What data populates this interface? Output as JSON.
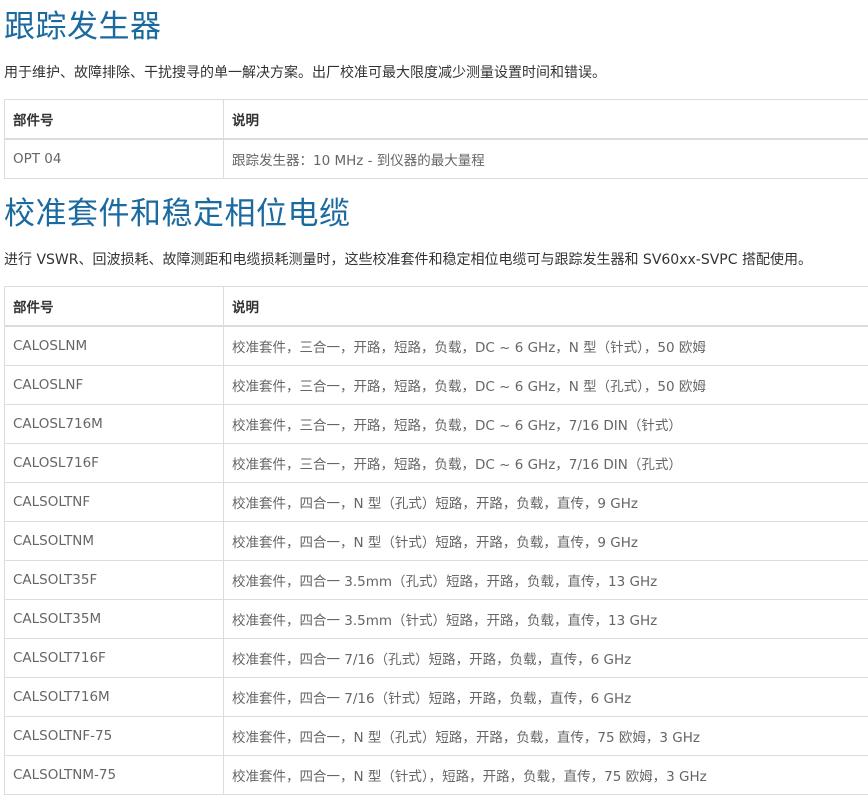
{
  "tracking_generator": {
    "title": "跟踪发生器",
    "description": "用于维护、故障排除、干扰搜寻的单一解决方案。出厂校准可最大限度减少测量设置时间和错误。",
    "headers": {
      "part": "部件号",
      "desc": "说明"
    },
    "rows": [
      {
        "part": "OPT 04",
        "desc": "跟踪发生器：10 MHz - 到仪器的最大量程"
      }
    ]
  },
  "calibration_kits": {
    "title": "校准套件和稳定相位电缆",
    "description": "进行 VSWR、回波损耗、故障测距和电缆损耗测量时，这些校准套件和稳定相位电缆可与跟踪发生器和 SV60xx-SVPC 搭配使用。",
    "headers": {
      "part": "部件号",
      "desc": "说明"
    },
    "rows": [
      {
        "part": "CALOSLNM",
        "desc": "校准套件，三合一，开路，短路，负载，DC ~ 6 GHz，N 型（针式），50 欧姆"
      },
      {
        "part": "CALOSLNF",
        "desc": "校准套件，三合一，开路，短路，负载，DC ~ 6 GHz，N 型（孔式），50 欧姆"
      },
      {
        "part": "CALOSL716M",
        "desc": "校准套件，三合一，开路，短路，负载，DC ~ 6 GHz，7/16 DIN（针式）"
      },
      {
        "part": "CALOSL716F",
        "desc": "校准套件，三合一，开路，短路，负载，DC ~ 6 GHz，7/16 DIN（孔式）"
      },
      {
        "part": "CALSOLTNF",
        "desc": "校准套件，四合一，N 型（孔式）短路，开路，负载，直传，9 GHz"
      },
      {
        "part": "CALSOLTNM",
        "desc": "校准套件，四合一，N 型（针式）短路，开路，负载，直传，9 GHz"
      },
      {
        "part": "CALSOLT35F",
        "desc": "校准套件，四合一 3.5mm（孔式）短路，开路，负载，直传，13 GHz"
      },
      {
        "part": "CALSOLT35M",
        "desc": "校准套件，四合一 3.5mm（针式）短路，开路，负载，直传，13 GHz"
      },
      {
        "part": "CALSOLT716F",
        "desc": "校准套件，四合一 7/16（孔式）短路，开路，负载，直传，6 GHz"
      },
      {
        "part": "CALSOLT716M",
        "desc": "校准套件，四合一 7/16（针式）短路，开路，负载，直传，6 GHz"
      },
      {
        "part": "CALSOLTNF-75",
        "desc": "校准套件，四合一，N 型（孔式）短路，开路，负载，直传，75 欧姆，3 GHz"
      },
      {
        "part": "CALSOLTNM-75",
        "desc": "校准套件，四合一，N 型（针式），短路，开路，负载，直传，75 欧姆，3 GHz"
      }
    ]
  }
}
